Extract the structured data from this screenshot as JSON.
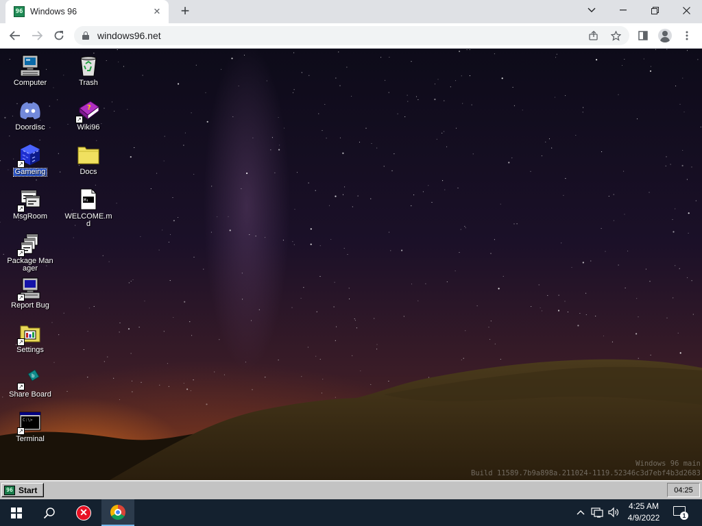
{
  "browser": {
    "tab": {
      "title": "Windows 96",
      "favicon": "windows96-favicon-icon"
    },
    "newtab_icon": "plus-icon",
    "window_controls": [
      "tab-search-icon",
      "minimize-icon",
      "restore-icon",
      "close-icon"
    ],
    "url": "windows96.net"
  },
  "desktop": {
    "icons": [
      {
        "label": "Computer",
        "icon": "computer-icon"
      },
      {
        "label": "Trash",
        "icon": "recycle-bin-icon"
      },
      {
        "label": "Doordisc",
        "icon": "discord-icon"
      },
      {
        "label": "Wiki96",
        "icon": "book-icon"
      },
      {
        "label": "Gameing",
        "icon": "game-cube-icon",
        "selected": true
      },
      {
        "label": "Docs",
        "icon": "folder-icon"
      },
      {
        "label": "MsgRoom",
        "icon": "chat-icon"
      },
      {
        "label": "WELCOME.md",
        "icon": "markdown-file-icon"
      },
      {
        "label": "Package Manager",
        "icon": "package-icon"
      },
      {
        "label": "Report Bug",
        "icon": "bug-report-icon"
      },
      {
        "label": "Settings",
        "icon": "settings-icon"
      },
      {
        "label": "Share Board",
        "icon": "share-board-icon"
      },
      {
        "label": "Terminal",
        "icon": "terminal-icon"
      }
    ],
    "watermark": {
      "line1": "Windows 96 main",
      "line2": "Build 11589.7b9a898a.211024-1119.52346c3d7ebf4b3d2683"
    }
  },
  "w96_taskbar": {
    "start_label": "Start",
    "clock": "04:25"
  },
  "win10_taskbar": {
    "time": "4:25 AM",
    "date": "4/9/2022",
    "notification_count": "1"
  }
}
